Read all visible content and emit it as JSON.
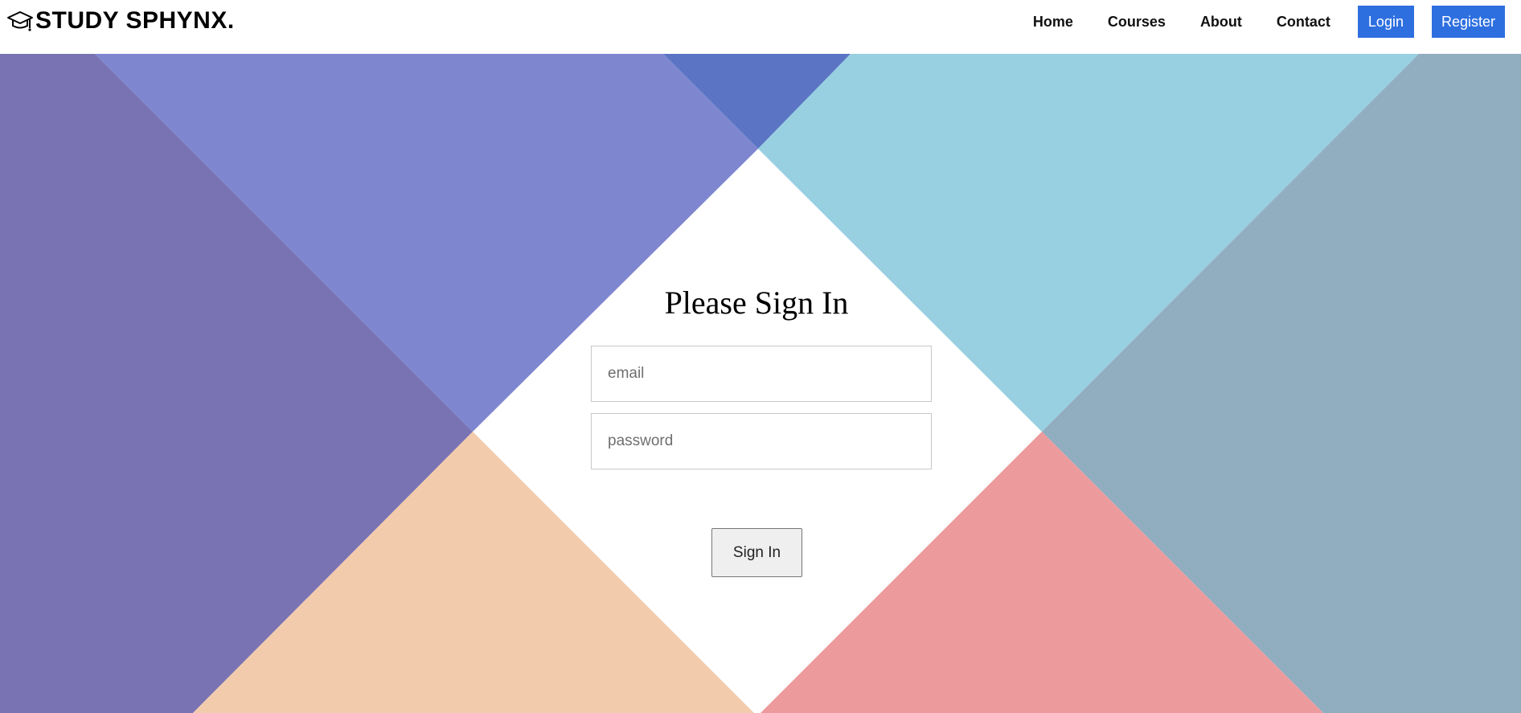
{
  "brand": {
    "name": "STUDY SPHYNX.",
    "icon": "graduation-cap-icon"
  },
  "nav": {
    "links": [
      "Home",
      "Courses",
      "About",
      "Contact"
    ],
    "login_label": "Login",
    "register_label": "Register"
  },
  "signin": {
    "title": "Please Sign In",
    "email_placeholder": "email",
    "password_placeholder": "password",
    "submit_label": "Sign In"
  },
  "colors": {
    "button_blue": "#2e6fe0",
    "purple": "#7a73b3",
    "periwinkle": "#7f86d0",
    "royal_blue": "#5b75c4",
    "light_blue": "#98d0e2",
    "slate_blue": "#91adc0",
    "peach": "#f2cbad",
    "salmon": "#ec9a9c"
  }
}
